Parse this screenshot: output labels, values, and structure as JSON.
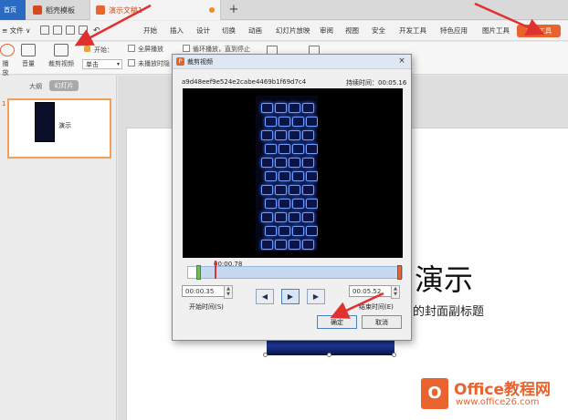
{
  "tabs": {
    "home": "首页",
    "template": "稻壳模板",
    "document": "演示文稿1",
    "add": "+"
  },
  "menubar": {
    "file": "≡ 文件 ∨",
    "items": [
      "开始",
      "插入",
      "设计",
      "切换",
      "动画",
      "幻灯片放映",
      "审阅",
      "视图",
      "安全",
      "开发工具",
      "特色应用",
      "图片工具"
    ],
    "video_tools": "视频工具"
  },
  "ribbon": {
    "play": "播放",
    "volume": "音量",
    "trim": "裁剪视频",
    "start_label": "开始：",
    "start_value": "单击",
    "fullscreen": "全屏播放",
    "hide_when_not_playing": "未播放时隐",
    "loop": "循环播放，直到停止"
  },
  "leftpanel": {
    "outline_tab": "大纲",
    "slides_tab": "幻灯片",
    "slide_number": "1",
    "thumb_text": "演示"
  },
  "slide": {
    "title": "演示",
    "subtitle": "的封面副标题"
  },
  "dialog": {
    "title": "裁剪视频",
    "close": "×",
    "filename": "a9d48eef9e524e2cabe4469b1f69d7c4",
    "duration": "持续时间：00:05.16",
    "current_time": "00:00.78",
    "start_time": "00:00.35",
    "end_time": "00:05.52",
    "start_label": "开始时间(S)",
    "end_label": "结束时间(E)",
    "prev": "◀",
    "play": "▶",
    "next": "▶",
    "ok": "确定",
    "cancel": "取消"
  },
  "watermark": {
    "brand": "Office教程网",
    "url": "www.office26.com"
  },
  "colors": {
    "accent": "#e8632e",
    "arrow": "#e03030",
    "home_tab": "#2b6ac3"
  }
}
